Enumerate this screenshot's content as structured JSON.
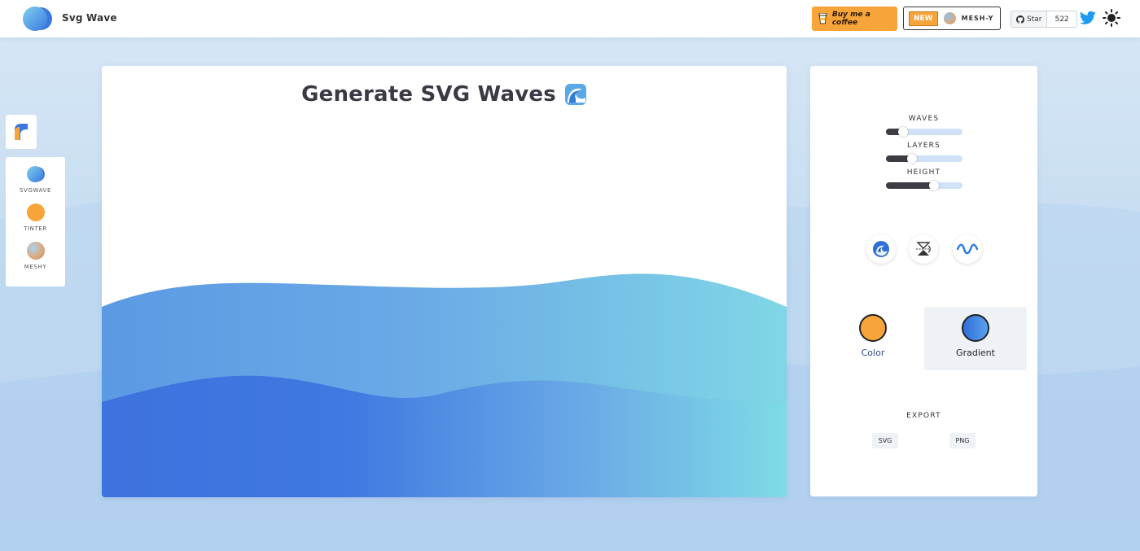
{
  "header": {
    "brand": "Svg Wave",
    "coffee_label": "Buy me a coffee",
    "new_badge": "NEW",
    "meshy_label": "MESH-Y",
    "github_star_label": "Star",
    "github_star_count": "522"
  },
  "sidebar": {
    "items": [
      {
        "label": "SVGWAVE",
        "color": "#5ab4e8"
      },
      {
        "label": "TINTER",
        "color": "#f7a43a"
      },
      {
        "label": "MESHY",
        "color": "#e3a36b"
      }
    ]
  },
  "main": {
    "title": "Generate SVG Waves"
  },
  "controls": {
    "sliders": [
      {
        "label": "WAVES",
        "value": 0.22
      },
      {
        "label": "LAYERS",
        "value": 0.34
      },
      {
        "label": "HEIGHT",
        "value": 0.63
      }
    ],
    "tools": [
      {
        "name": "randomize-icon"
      },
      {
        "name": "flip-icon"
      },
      {
        "name": "wave-style-icon"
      }
    ],
    "modes": {
      "color_label": "Color",
      "color_swatch": "#f7a43a",
      "gradient_label": "Gradient",
      "gradient_swatch": "#3a77e0",
      "active": "Gradient"
    },
    "export_label": "EXPORT",
    "export_svg": "SVG",
    "export_png": "PNG"
  },
  "colors": {
    "wave_top_start": "#6aa8e6",
    "wave_top_end": "#7dd6e6",
    "wave_bottom_start": "#3f73df",
    "wave_bottom_end": "#7ddae6",
    "accent": "#f7a43a"
  }
}
